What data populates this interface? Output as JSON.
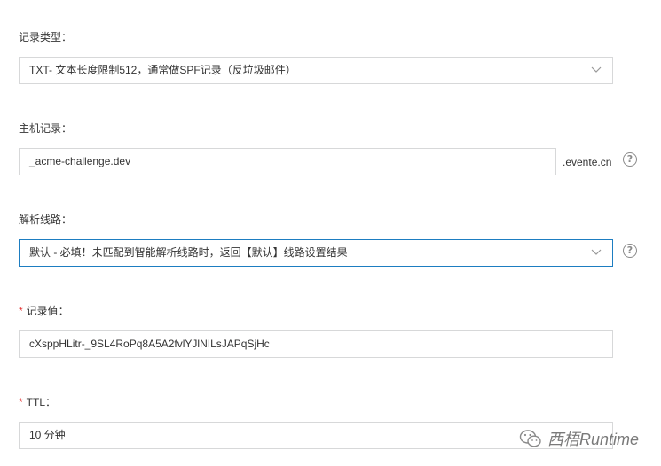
{
  "record_type": {
    "label": "记录类型：",
    "value": "TXT- 文本长度限制512，通常做SPF记录（反垃圾邮件）"
  },
  "host_record": {
    "label": "主机记录：",
    "value": "_acme-challenge.dev",
    "suffix": ".evente.cn"
  },
  "line": {
    "label": "解析线路：",
    "value": "默认 - 必填！未匹配到智能解析线路时，返回【默认】线路设置结果"
  },
  "record_value": {
    "required_mark": "*",
    "label": "记录值：",
    "value": "cXsppHLitr-_9SL4RoPq8A5A2fvlYJlNILsJAPqSjHc"
  },
  "ttl": {
    "required_mark": "*",
    "label": "TTL：",
    "value": "10 分钟"
  },
  "help_glyph": "?",
  "watermark": {
    "text": "西梧Runtime"
  }
}
